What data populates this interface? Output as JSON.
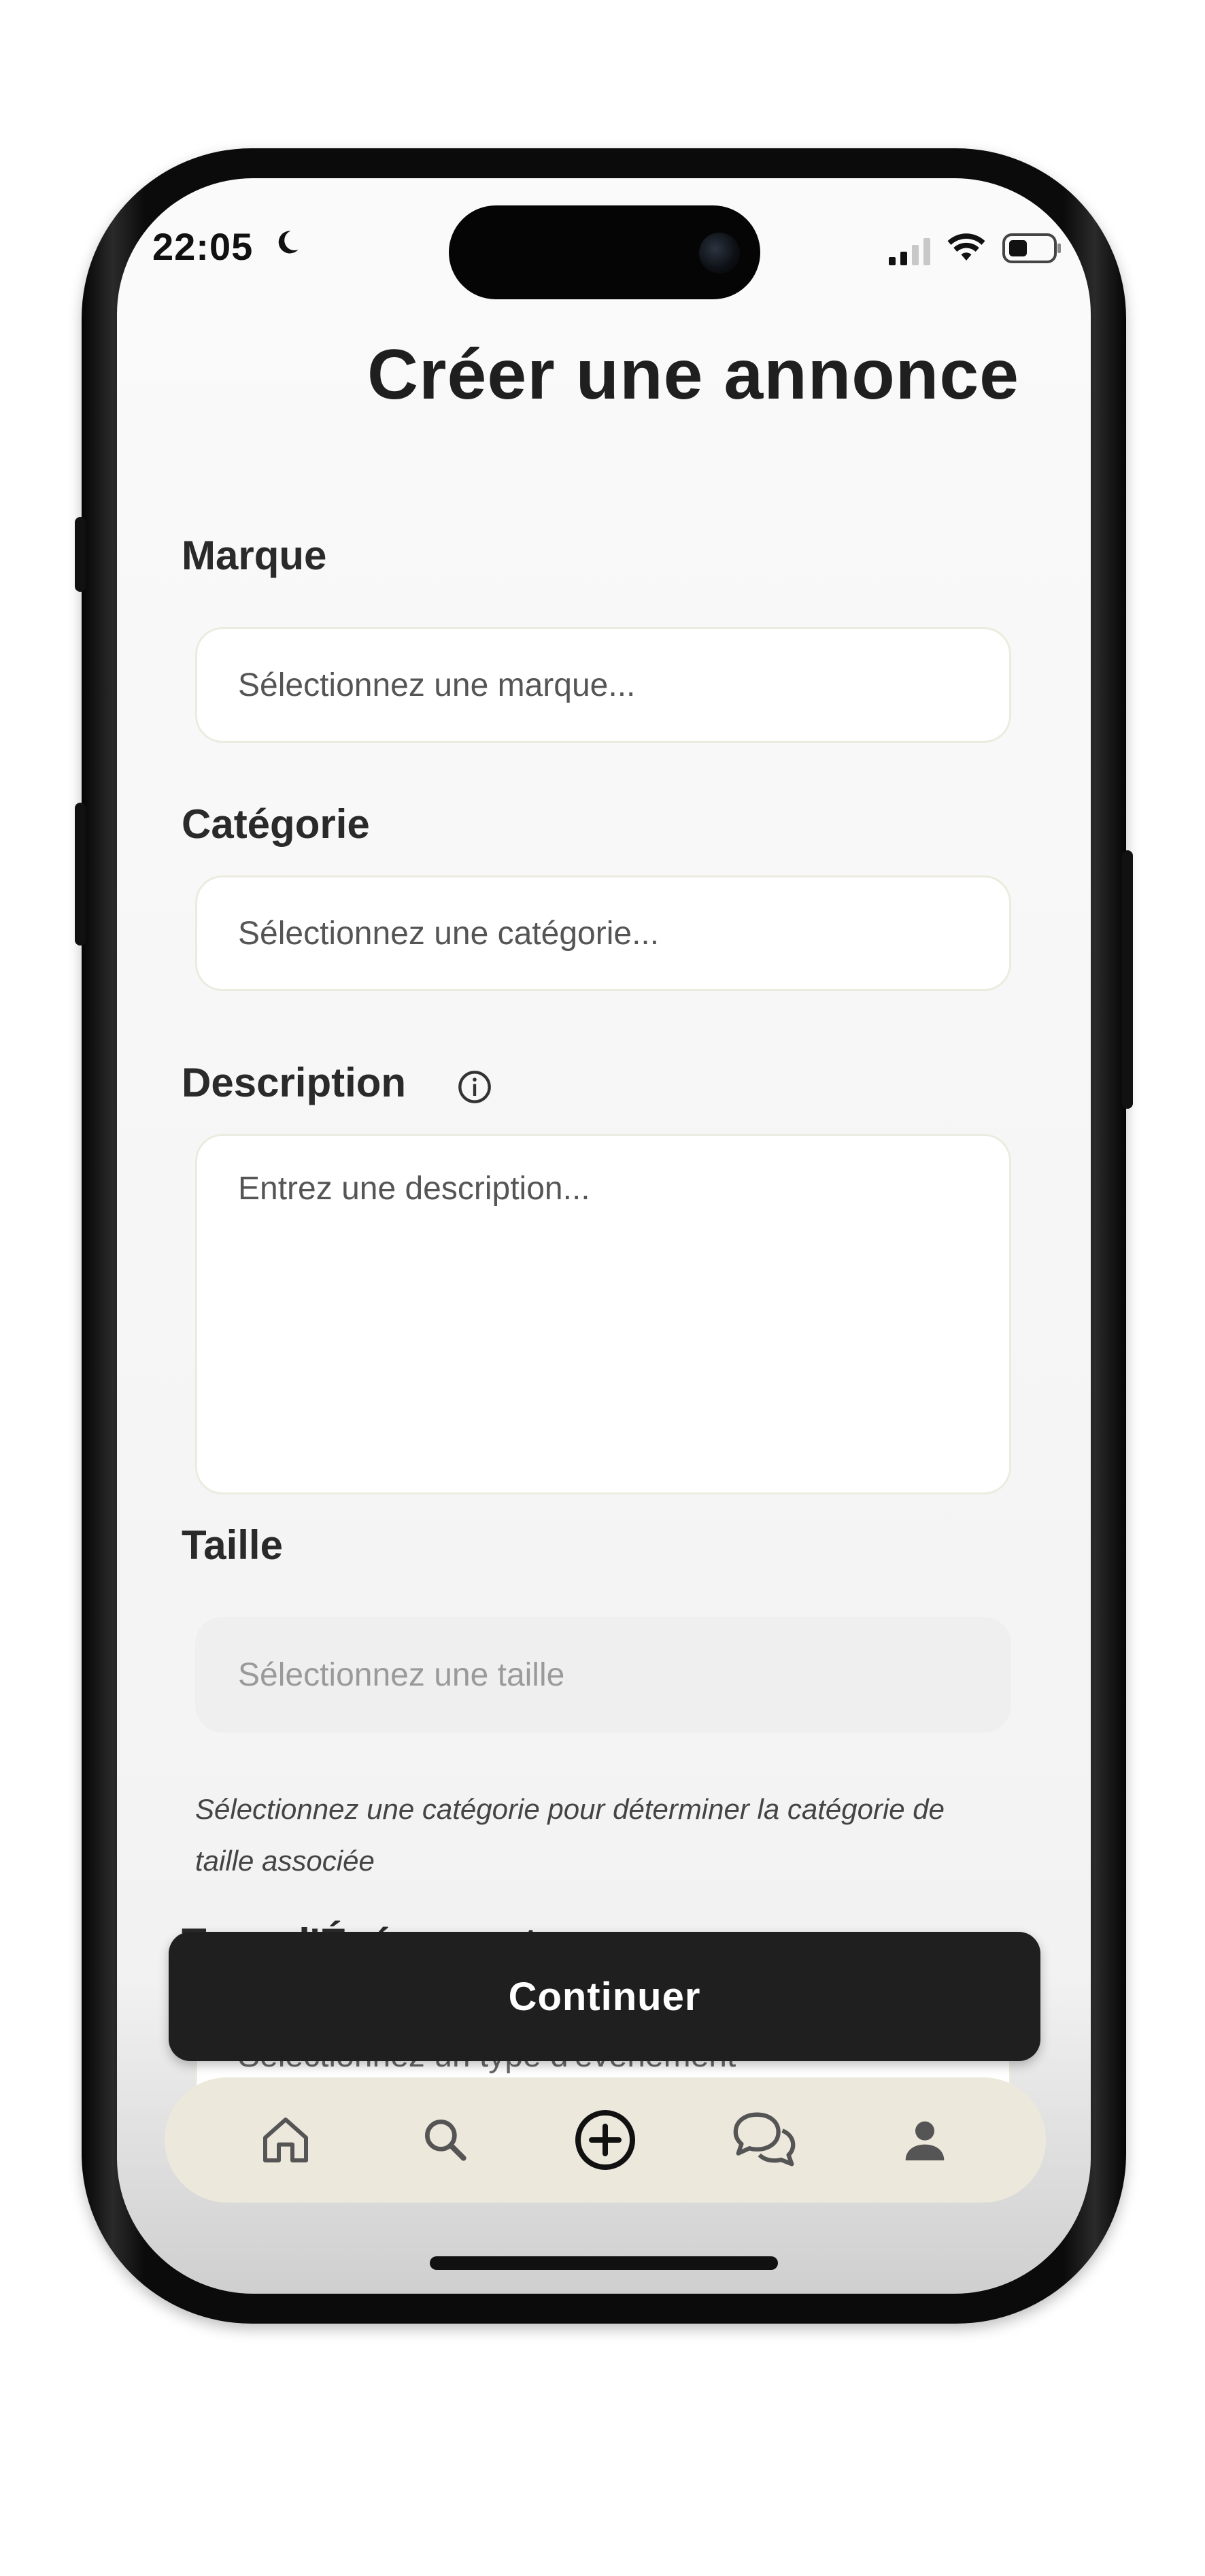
{
  "status_bar": {
    "time": "22:05",
    "icons": [
      "moon-icon",
      "signal-icon",
      "wifi-icon",
      "battery-icon"
    ]
  },
  "page": {
    "title": "Créer une annonce"
  },
  "form": {
    "brand": {
      "label": "Marque",
      "placeholder": "Sélectionnez une marque..."
    },
    "category": {
      "label": "Catégorie",
      "placeholder": "Sélectionnez une catégorie..."
    },
    "description": {
      "label": "Description",
      "placeholder": "Entrez une description...",
      "info_icon": "info-icon"
    },
    "size": {
      "label": "Taille",
      "placeholder": "Sélectionnez une taille",
      "hint": "Sélectionnez une catégorie pour déterminer la catégorie de taille associée"
    },
    "event_type": {
      "label": "Type d'Événement",
      "placeholder": "Sélectionnez un type d'événement"
    }
  },
  "actions": {
    "continue_label": "Continuer"
  },
  "tabbar": {
    "items": [
      {
        "icon": "home-icon",
        "active": false
      },
      {
        "icon": "search-icon",
        "active": false
      },
      {
        "icon": "add-circle-icon",
        "active": true
      },
      {
        "icon": "chat-icon",
        "active": false
      },
      {
        "icon": "profile-icon",
        "active": false
      }
    ]
  },
  "colors": {
    "accent_dark": "#1f1f1f",
    "tabbar_bg": "#ede8dc",
    "field_border": "#ecebdf",
    "disabled_field": "#efefef"
  }
}
